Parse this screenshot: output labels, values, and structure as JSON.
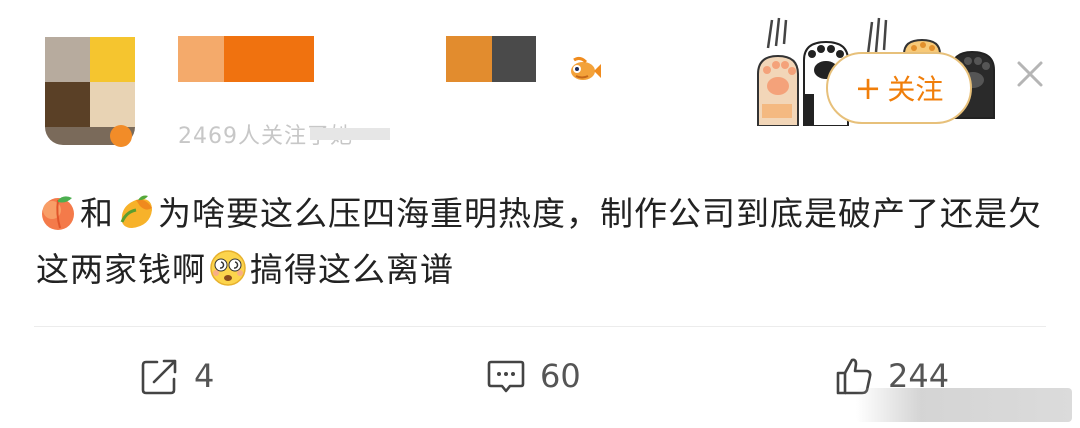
{
  "header": {
    "subtitle": "2469人关注了她",
    "follow_plus": "+",
    "follow_label": "关注"
  },
  "post": {
    "text_part1": "和",
    "text_part2": "为啥要这么压四海重明热度，制作公司到底是破产了还是欠这两家钱啊",
    "text_part3": "搞得这么离谱"
  },
  "actions": {
    "share_count": "4",
    "comment_count": "60",
    "like_count": "244"
  },
  "colors": {
    "accent": "#f07e0a",
    "follow_border": "#e7c07a",
    "text": "#222222",
    "muted": "#c7c7c7"
  },
  "icons": [
    "peach-emoji",
    "mango-emoji",
    "dizzy-face-emoji",
    "fish-icon",
    "share-icon",
    "comment-icon",
    "like-icon",
    "close-icon",
    "cat-paw-decoration"
  ]
}
